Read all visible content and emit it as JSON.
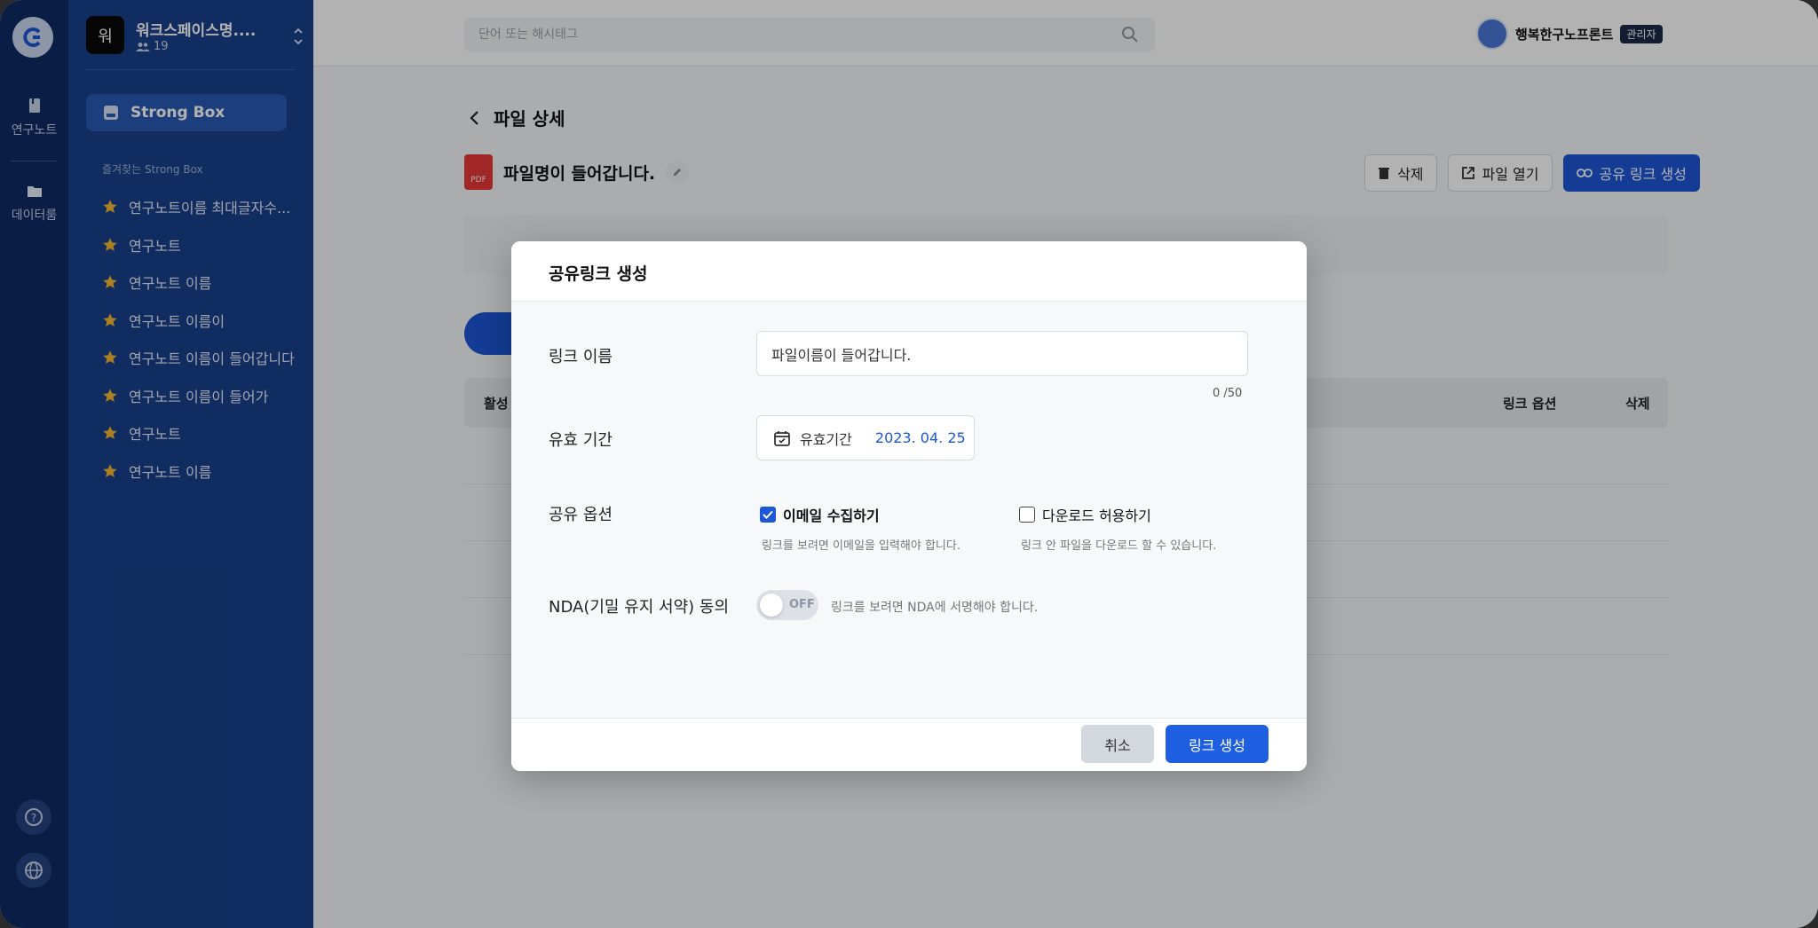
{
  "rail": {
    "items": [
      {
        "label": "연구노트",
        "icon": "notebook-icon"
      },
      {
        "label": "데이터룸",
        "icon": "folder-icon"
      }
    ]
  },
  "workspace": {
    "avatar_letter": "워",
    "name": "워크스페이스명....",
    "members": "19"
  },
  "sidebar": {
    "strongbox_label": "Strong Box",
    "favorites_title": "즐겨찾는 Strong Box",
    "favorites": [
      "연구노트이름 최대글자수...",
      "연구노트",
      "연구노트 이름",
      "연구노트 이름이",
      "연구노트 이름이 들어갑니다",
      "연구노트 이름이 들어가",
      "연구노트",
      "연구노트 이름"
    ]
  },
  "topbar": {
    "search_placeholder": "단어 또는 해시태그",
    "user_name": "행복한구노프론트",
    "user_badge": "관리자"
  },
  "page": {
    "title": "파일 상세",
    "file_name": "파일명이 들어갑니다.",
    "pdf_label": "PDF",
    "actions": {
      "delete": "삭제",
      "open": "파일 열기",
      "share": "공유 링크 생성"
    },
    "table_headers": {
      "active": "활성",
      "link_options": "링크 옵션",
      "delete": "삭제"
    }
  },
  "modal": {
    "title": "공유링크 생성",
    "link_name_label": "링크 이름",
    "link_name_value": "파일이름이 들어갑니다.",
    "counter": "0 /50",
    "expiry_label": "유효 기간",
    "expiry_field_label": "유효기간",
    "expiry_date": "2023. 04. 25",
    "share_options_label": "공유 옵션",
    "email_option": "이메일 수집하기",
    "email_help": "링크를 보려면 이메일을 입력해야 합니다.",
    "email_checked": true,
    "download_option": "다운로드 허용하기",
    "download_help": "링크 안 파일을 다운로드 할 수 있습니다.",
    "download_checked": false,
    "nda_label": "NDA(기밀 유지 서약) 동의",
    "nda_toggle": "OFF",
    "nda_help": "링크를 보려면 NDA에 서명해야 합니다.",
    "cancel": "취소",
    "create": "링크 생성"
  },
  "colors": {
    "primary": "#1d57d6",
    "rail_bg": "#0e2a63",
    "sidebar_bg": "#19408a",
    "star": "#f5b82e"
  }
}
